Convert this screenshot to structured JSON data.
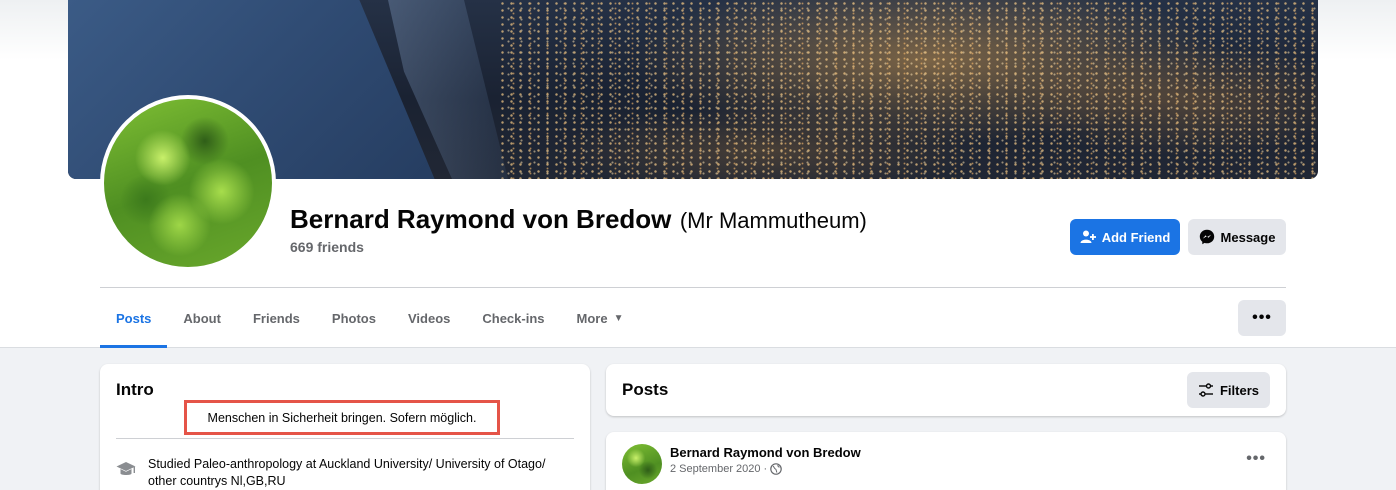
{
  "profile": {
    "name": "Bernard Raymond von Bredow",
    "alt_name": "(Mr Mammutheum)",
    "friends_count": "669 friends"
  },
  "actions": {
    "add_friend": "Add Friend",
    "message": "Message"
  },
  "tabs": [
    {
      "label": "Posts",
      "active": true
    },
    {
      "label": "About"
    },
    {
      "label": "Friends"
    },
    {
      "label": "Photos"
    },
    {
      "label": "Videos"
    },
    {
      "label": "Check-ins"
    },
    {
      "label": "More"
    }
  ],
  "more_options": "•••",
  "intro": {
    "title": "Intro",
    "bio": "Menschen in Sicherheit bringen. Sofern möglich.",
    "education": "Studied Paleo-anthropology at Auckland University/ University of Otago/ other countrys Nl,GB,RU"
  },
  "posts_section": {
    "title": "Posts",
    "filters_label": "Filters"
  },
  "post": {
    "author": "Bernard Raymond von Bredow",
    "date": "2 September 2020",
    "separator": "·",
    "options": "•••"
  },
  "colors": {
    "accent": "#1b74e4",
    "highlight_border": "#e55448",
    "secondary_button": "#e4e6eb",
    "page_background": "#f0f2f5"
  }
}
